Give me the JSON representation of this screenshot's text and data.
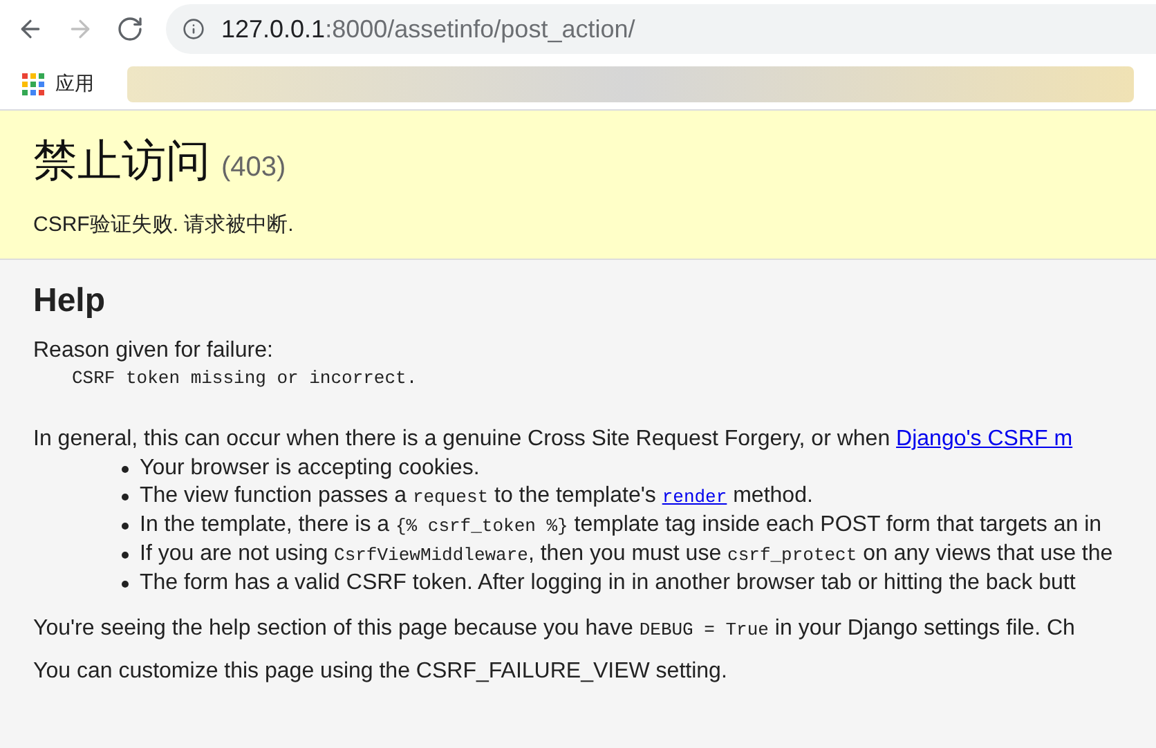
{
  "browser": {
    "url_host": "127.0.0.1",
    "url_path": ":8000/assetinfo/post_action/",
    "bookmarks": [
      {
        "label": "应用"
      }
    ]
  },
  "summary": {
    "title": "禁止访问",
    "code": "(403)",
    "message": "CSRF验证失败. 请求被中断."
  },
  "help": {
    "title": "Help",
    "reason_label": "Reason given for failure:",
    "reason": "CSRF token missing or incorrect.",
    "intro": [
      {
        "kind": "text",
        "text": "In general, this can occur when there is a genuine Cross Site Request Forgery, or when "
      },
      {
        "kind": "link",
        "text": "Django's CSRF m"
      }
    ],
    "items": [
      [
        {
          "kind": "text",
          "text": "Your browser is accepting cookies."
        }
      ],
      [
        {
          "kind": "text",
          "text": "The view function passes a "
        },
        {
          "kind": "code",
          "text": "request"
        },
        {
          "kind": "text",
          "text": " to the template's "
        },
        {
          "kind": "codelink",
          "text": "render"
        },
        {
          "kind": "text",
          "text": " method."
        }
      ],
      [
        {
          "kind": "text",
          "text": "In the template, there is a "
        },
        {
          "kind": "code",
          "text": "{% csrf_token %}"
        },
        {
          "kind": "text",
          "text": " template tag inside each POST form that targets an in"
        }
      ],
      [
        {
          "kind": "text",
          "text": "If you are not using "
        },
        {
          "kind": "code",
          "text": "CsrfViewMiddleware"
        },
        {
          "kind": "text",
          "text": ", then you must use "
        },
        {
          "kind": "code",
          "text": "csrf_protect"
        },
        {
          "kind": "text",
          "text": " on any views that use the"
        }
      ],
      [
        {
          "kind": "text",
          "text": "The form has a valid CSRF token. After logging in in another browser tab or hitting the back butt"
        }
      ]
    ],
    "debug_note": [
      {
        "kind": "text",
        "text": "You're seeing the help section of this page because you have "
      },
      {
        "kind": "code",
        "text": "DEBUG = True"
      },
      {
        "kind": "text",
        "text": " in your Django settings file. Ch"
      }
    ],
    "customize_note": [
      {
        "kind": "text",
        "text": "You can customize this page using the CSRF_FAILURE_VIEW setting."
      }
    ]
  }
}
